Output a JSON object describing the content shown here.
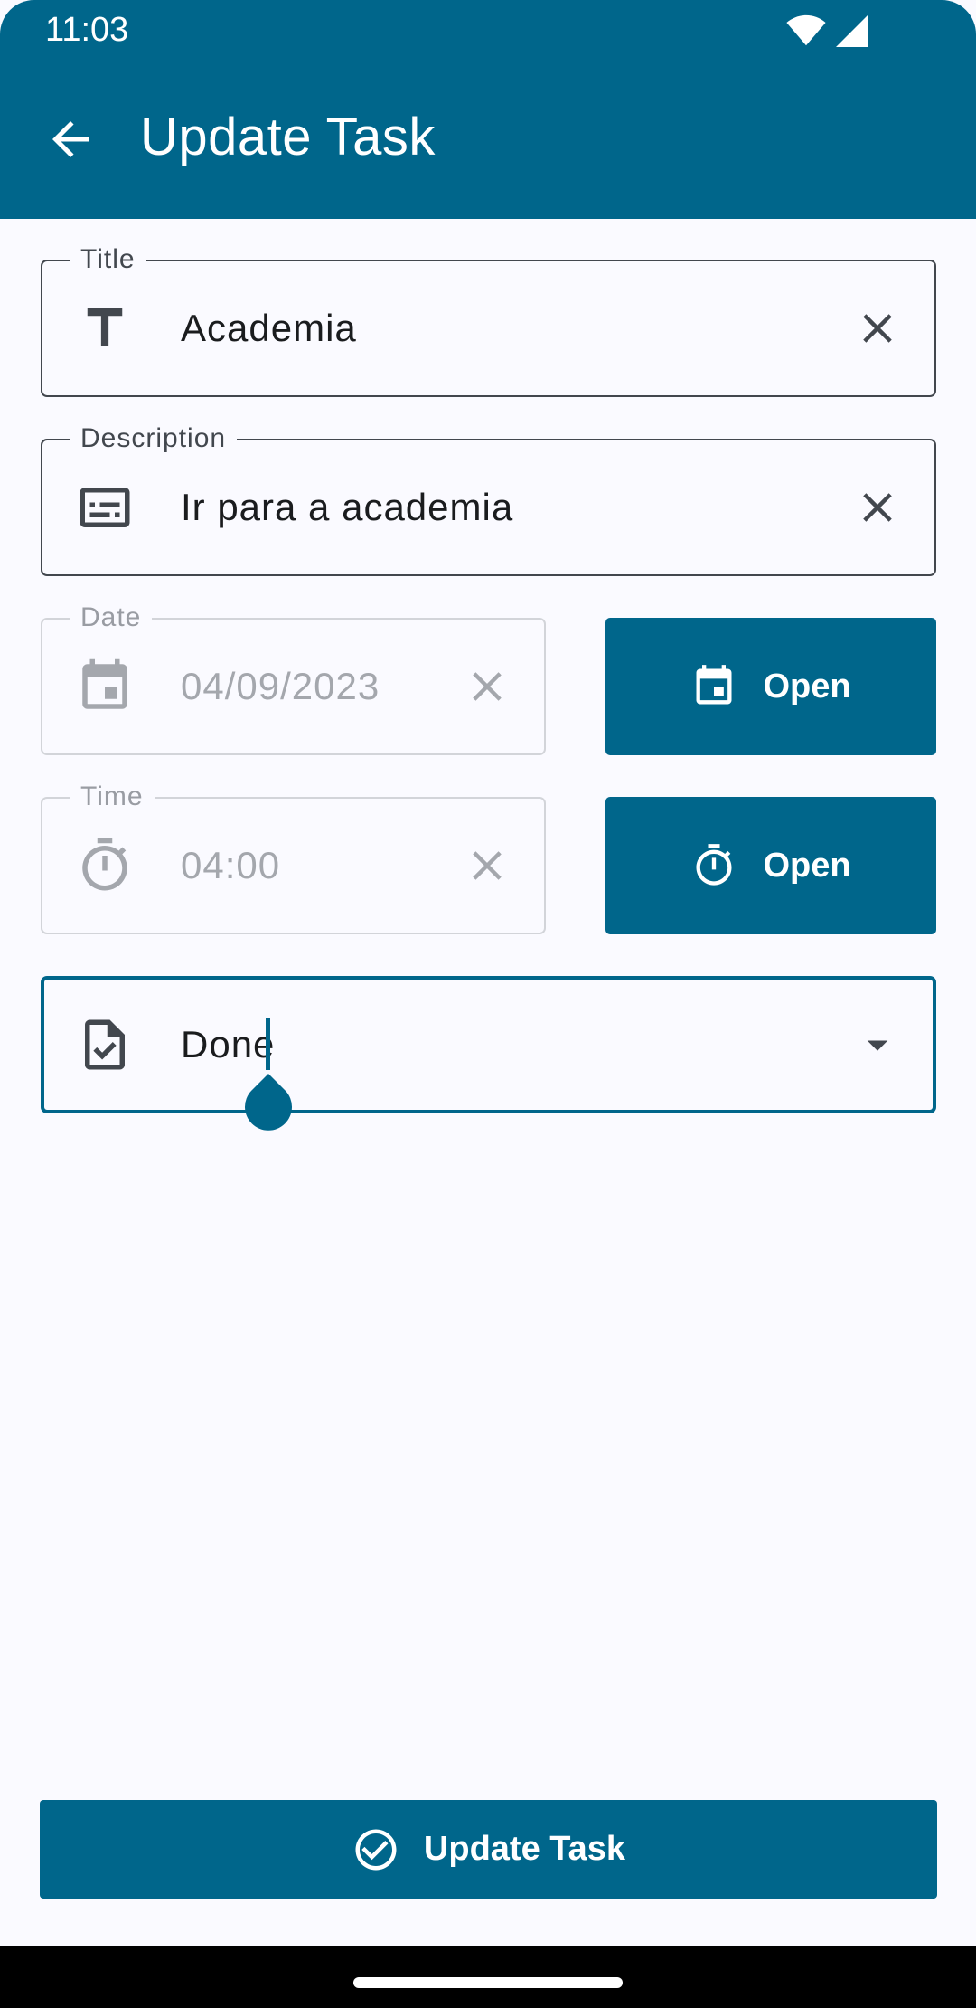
{
  "status_bar": {
    "time": "11:03",
    "icons": [
      "wifi-icon",
      "signal-icon"
    ]
  },
  "app_bar": {
    "title": "Update Task",
    "back_icon": "arrow-back-icon"
  },
  "form": {
    "title": {
      "label": "Title",
      "value": "Academia",
      "icon": "text-icon",
      "clear_icon": "close-icon"
    },
    "description": {
      "label": "Description",
      "value": "Ir para a academia",
      "icon": "subtitles-icon",
      "clear_icon": "close-icon"
    },
    "date": {
      "label": "Date",
      "value": "04/09/2023",
      "icon": "calendar-icon",
      "clear_icon": "close-icon",
      "button_label": "Open"
    },
    "time": {
      "label": "Time",
      "value": "04:00",
      "icon": "timer-icon",
      "clear_icon": "close-icon",
      "button_label": "Open"
    },
    "status": {
      "value": "Done",
      "icon": "task-check-icon",
      "dropdown_icon": "arrow-drop-down-icon"
    }
  },
  "submit": {
    "label": "Update Task",
    "icon": "check-circle-icon"
  },
  "colors": {
    "primary": "#00668b",
    "background": "#fafaff",
    "outline": "#42474e",
    "disabled": "#a4a7ad"
  }
}
